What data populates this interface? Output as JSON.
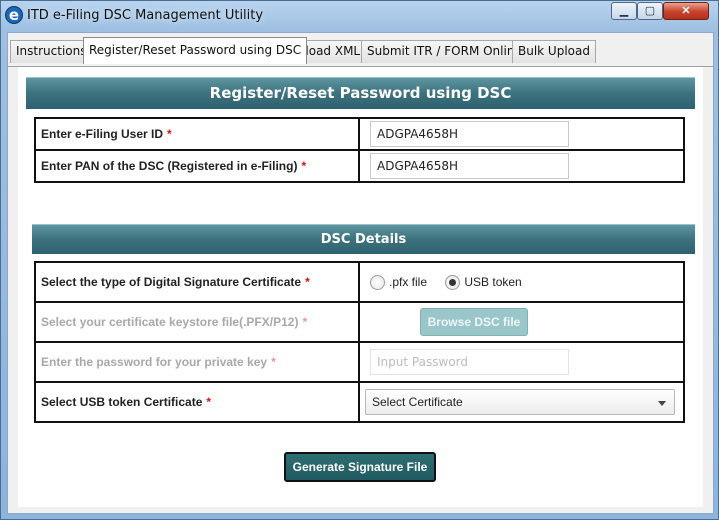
{
  "window": {
    "title": "ITD e-Filing DSC Management Utility",
    "app_icon_glyph": "e",
    "controls": {
      "minimize": "▁",
      "maximize": "▢",
      "close": "✕"
    }
  },
  "tabs": [
    {
      "label": "Instructions",
      "active": false
    },
    {
      "label": "Register/Reset Password using DSC",
      "active": true
    },
    {
      "label": "Upload XML",
      "active": false
    },
    {
      "label": "Submit ITR / FORM Online",
      "active": false
    },
    {
      "label": "Bulk Upload",
      "active": false
    }
  ],
  "form": {
    "header": "Register/Reset Password using DSC",
    "user_id_label": "Enter e-Filing User ID",
    "user_id_value": "ADGPA4658H",
    "pan_label": "Enter PAN of the DSC (Registered in e-Filing)",
    "pan_value": "ADGPA4658H",
    "required_marker": "*"
  },
  "dsc": {
    "header": "DSC Details",
    "type_label": "Select the type of Digital Signature Certificate",
    "option_pfx": ".pfx file",
    "option_usb": "USB token",
    "selected_type": "USB token",
    "keystore_label": "Select your certificate keystore file(.PFX/P12)",
    "browse_button": "Browse DSC file",
    "password_label": "Enter the password for your private key",
    "password_placeholder": "Input Password",
    "usb_cert_label": "Select USB token Certificate",
    "usb_cert_value": "Select Certificate"
  },
  "actions": {
    "generate_button": "Generate Signature File"
  },
  "colors": {
    "header_teal": "#3c727e",
    "button_teal": "#1f5a60",
    "required_red": "#d11111"
  }
}
